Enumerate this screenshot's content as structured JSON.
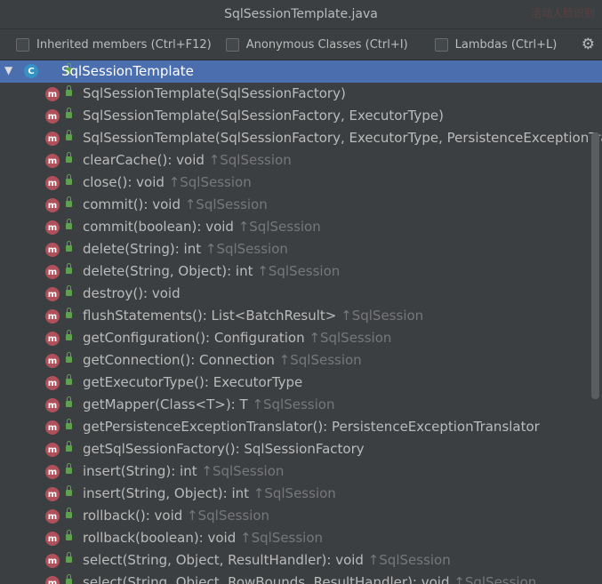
{
  "window": {
    "title": "SqlSessionTemplate.java",
    "watermark": "活动人脸识别"
  },
  "options": {
    "inherited": "Inherited members (Ctrl+F12)",
    "anonymous": "Anonymous Classes (Ctrl+I)",
    "lambdas": "Lambdas (Ctrl+L)",
    "settings_icon": "gear-icon"
  },
  "tree": {
    "root": {
      "label": "SqlSessionTemplate",
      "icon": "class-icon"
    },
    "items": [
      {
        "sig": "SqlSessionTemplate(SqlSessionFactory)",
        "from": ""
      },
      {
        "sig": "SqlSessionTemplate(SqlSessionFactory, ExecutorType)",
        "from": ""
      },
      {
        "sig": "SqlSessionTemplate(SqlSessionFactory, ExecutorType, PersistenceExceptionTran",
        "from": ""
      },
      {
        "sig": "clearCache(): void ",
        "from": "↑SqlSession"
      },
      {
        "sig": "close(): void ",
        "from": "↑SqlSession"
      },
      {
        "sig": "commit(): void ",
        "from": "↑SqlSession"
      },
      {
        "sig": "commit(boolean): void ",
        "from": "↑SqlSession"
      },
      {
        "sig": "delete(String): int ",
        "from": "↑SqlSession"
      },
      {
        "sig": "delete(String, Object): int ",
        "from": "↑SqlSession"
      },
      {
        "sig": "destroy(): void",
        "from": ""
      },
      {
        "sig": "flushStatements(): List<BatchResult> ",
        "from": "↑SqlSession"
      },
      {
        "sig": "getConfiguration(): Configuration ",
        "from": "↑SqlSession"
      },
      {
        "sig": "getConnection(): Connection ",
        "from": "↑SqlSession"
      },
      {
        "sig": "getExecutorType(): ExecutorType",
        "from": ""
      },
      {
        "sig": "getMapper(Class<T>): T ",
        "from": "↑SqlSession"
      },
      {
        "sig": "getPersistenceExceptionTranslator(): PersistenceExceptionTranslator",
        "from": ""
      },
      {
        "sig": "getSqlSessionFactory(): SqlSessionFactory",
        "from": ""
      },
      {
        "sig": "insert(String): int ",
        "from": "↑SqlSession"
      },
      {
        "sig": "insert(String, Object): int ",
        "from": "↑SqlSession"
      },
      {
        "sig": "rollback(): void ",
        "from": "↑SqlSession"
      },
      {
        "sig": "rollback(boolean): void ",
        "from": "↑SqlSession"
      },
      {
        "sig": "select(String, Object, ResultHandler): void ",
        "from": "↑SqlSession"
      },
      {
        "sig": "select(String, Object, RowBounds, ResultHandler): void ",
        "from": "↑SqlSession"
      }
    ]
  }
}
